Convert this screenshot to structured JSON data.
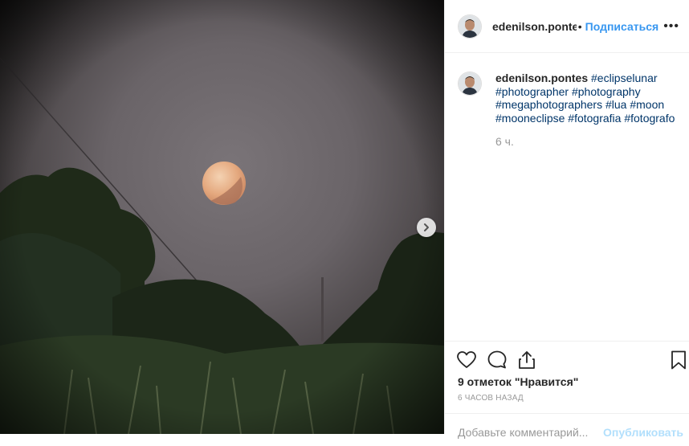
{
  "post": {
    "author": "edenilson.pontes",
    "separator": "•",
    "follow_label": "Подписаться",
    "more_label": "•••",
    "caption_author": "edenilson.pontes",
    "hashtags": [
      "#eclipselunar",
      "#photographer",
      "#photography",
      "#megaphotographers",
      "#lua",
      "#moon",
      "#mooneclipse",
      "#fotografia",
      "#fotografo"
    ],
    "caption_time": "6 ч.",
    "likes": "9 отметок \"Нравится\"",
    "time_ago": "6 ЧАСОВ НАЗАД"
  },
  "comment": {
    "placeholder": "Добавьте комментарий...",
    "publish_label": "Опубликовать"
  },
  "icons": {
    "next": "chevron-right-icon",
    "like": "heart-icon",
    "comment": "comment-icon",
    "share": "share-icon",
    "save": "bookmark-icon"
  },
  "colors": {
    "link": "#3897f0",
    "hashtag": "#003569",
    "muted": "#999999"
  }
}
